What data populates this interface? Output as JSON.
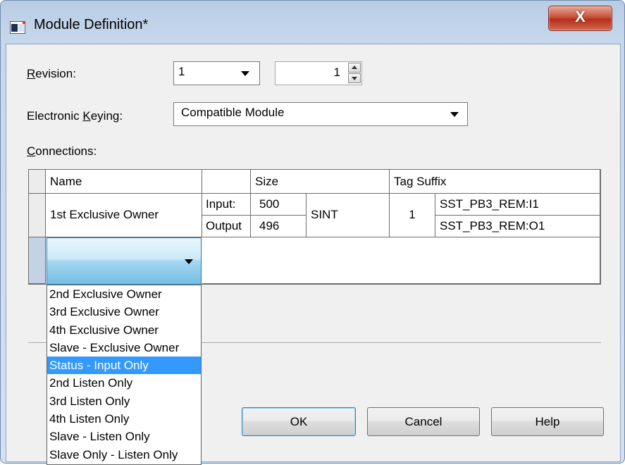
{
  "window": {
    "title": "Module Definition*",
    "close_glyph": "X"
  },
  "revision": {
    "label_u": "R",
    "label_rest": "evision:",
    "major_value": "1",
    "minor_value": "1"
  },
  "keying": {
    "label_pre": "Electronic ",
    "label_u": "K",
    "label_rest": "eying:",
    "value": "Compatible Module"
  },
  "connections": {
    "label_u": "C",
    "label_rest": "onnections:",
    "headers": {
      "name": "Name",
      "blank": "",
      "size": "Size",
      "tag_suffix": "Tag Suffix"
    },
    "row": {
      "name": "1st Exclusive Owner",
      "input_label": "Input:",
      "output_label": "Output",
      "input_size": "500",
      "output_size": "496",
      "type": "SINT",
      "rpi": "1",
      "input_tag": "SST_PB3_REM:I1",
      "output_tag": "SST_PB3_REM:O1"
    }
  },
  "dropdown": {
    "items": [
      "2nd Exclusive Owner",
      "3rd Exclusive Owner",
      "4th Exclusive Owner",
      "Slave - Exclusive Owner",
      "Status - Input Only",
      "2nd Listen Only",
      "3rd Listen Only",
      "4th Listen Only",
      "Slave - Listen Only",
      "Slave Only - Listen Only"
    ],
    "selected_index": 4
  },
  "buttons": {
    "ok": "OK",
    "cancel": "Cancel",
    "help": "Help"
  },
  "colors": {
    "selection": "#3399ff",
    "close_button": "#c7513a",
    "frame": "#c7d8ec"
  }
}
